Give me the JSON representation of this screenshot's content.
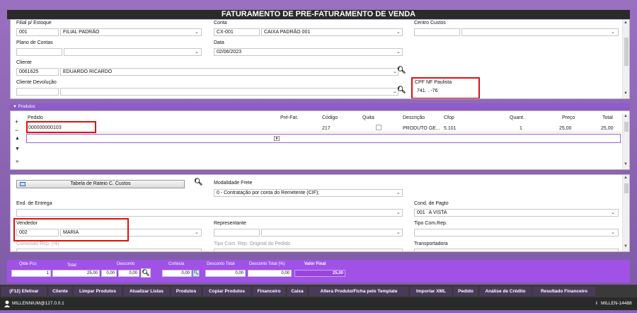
{
  "title": "FATURAMENTO DE PRE-FATURAMENTO DE VENDA",
  "header": {
    "filial_label": "Filial p/ Estoque",
    "filial_code": "001",
    "filial_name": "FILIAL PADRÃO",
    "conta_label": "Conta",
    "conta_code": "CX-001",
    "conta_name": "CAIXA PADRÃO 001",
    "centro_label": "Centro Custos",
    "plano_label": "Plano de Contas",
    "data_label": "Data",
    "data_value": "02/06/2023",
    "cliente_label": "Cliente",
    "cliente_code": "0061625",
    "cliente_name": "EDUARDO RICARDO",
    "cliente_dev_label": "Cliente Devolução",
    "cpf_label": "CPF NF Paulista",
    "cpf_value": "741.    .    -76"
  },
  "produtos": {
    "section_label": "Produtos",
    "columns": {
      "pedido": "Pedido",
      "prefat": "Pré-Fat.",
      "codigo": "Código",
      "quita": "Quita",
      "descricao": "Descrição",
      "cfop": "Cfop",
      "quant": "Quant.",
      "preco": "Preço",
      "total": "Total"
    },
    "row": {
      "pedido": "000000000103",
      "codigo": "217",
      "descricao": "PRODUTO GE...",
      "cfop": "5.101",
      "quant": "1",
      "preco": "25,00",
      "total": "25,00"
    }
  },
  "lower": {
    "rateio_button": "Tabela de Rateio C. Custos",
    "modalidade_label": "Modalidade Frete",
    "modalidade_value": "0 - Contratação por conta do Remetente (CIF);",
    "end_entrega_label": "End. de Entrega",
    "cond_pagto_label": "Cond. de Pagto",
    "cond_pagto_code": "001",
    "cond_pagto_name": "A VISTA",
    "vendedor_label": "Vendedor",
    "vendedor_code": "002",
    "vendedor_name": "MARIA",
    "representante_label": "Representante",
    "tipo_com_label": "Tipo Com.Rep.",
    "comissao_label": "Comissão Rep. (%)",
    "tipo_com_orig_label": "Tipo Com. Rep. Original do Pedido",
    "transportadora_label": "Transportadora"
  },
  "totals": {
    "qtde_label": "Qtde Pcs",
    "qtde_value": "1",
    "total_label": "Total",
    "total_value": "25,00",
    "desconto_label": "Desconto",
    "desconto_a": "0,00",
    "desconto_b": "0,00",
    "cortesia_label": "Cortesia",
    "cortesia_value": "0,00",
    "desc_total_label": "Desconto Total",
    "desc_total_value": "0,00",
    "desc_total_pct_label": "Desconto Total (%)",
    "desc_total_pct_value": "0,00",
    "valor_final_label": "Valor Final",
    "valor_final_value": "25,00"
  },
  "buttons": [
    "(F12) Efetivar",
    "Cliente",
    "Limpar Produtos",
    "Atualizar Listas",
    "Produtos",
    "Copiar Produtos",
    "Financeiro",
    "Caixa",
    "Altera Produto/Ficha pelo Template",
    "Importar XML",
    "Pedido",
    "Análise de Crédito",
    "Resultado Financeiro"
  ],
  "status": {
    "user": "MILLENNIUM@127.0.0.1",
    "server": "MILLEN-14488"
  },
  "colors": {
    "frame": "#8a63b0",
    "accent": "#a052e6",
    "highlight": "#e01010"
  }
}
